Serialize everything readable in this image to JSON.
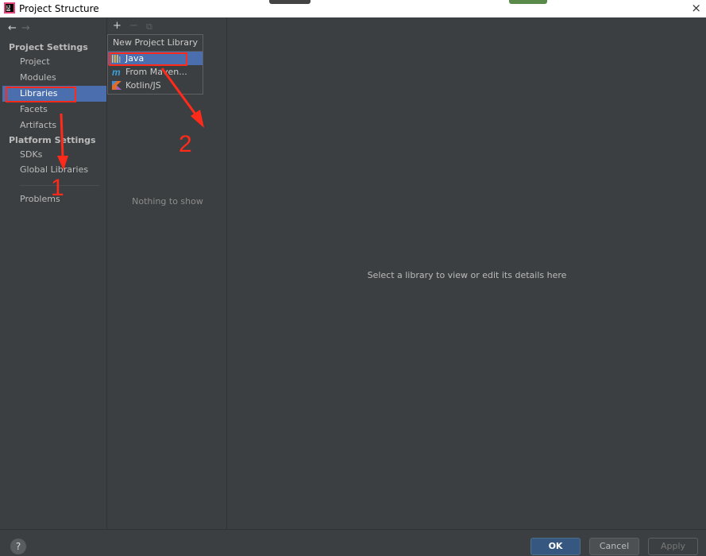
{
  "window": {
    "title": "Project Structure",
    "close_glyph": "×"
  },
  "sidebar": {
    "back_icon": "←",
    "forward_icon": "→",
    "project_settings_header": "Project Settings",
    "project_settings_items": [
      {
        "label": "Project",
        "selected": false
      },
      {
        "label": "Modules",
        "selected": false
      },
      {
        "label": "Libraries",
        "selected": true
      },
      {
        "label": "Facets",
        "selected": false
      },
      {
        "label": "Artifacts",
        "selected": false
      }
    ],
    "platform_settings_header": "Platform Settings",
    "platform_settings_items": [
      {
        "label": "SDKs"
      },
      {
        "label": "Global Libraries"
      }
    ],
    "problems_label": "Problems"
  },
  "library_panel": {
    "add_icon": "+",
    "remove_icon": "−",
    "copy_icon": "⧉",
    "empty_text": "Nothing to show"
  },
  "popup": {
    "header": "New Project Library",
    "items": [
      {
        "label": "Java",
        "icon": "java-library-icon",
        "selected": true
      },
      {
        "label": "From Maven...",
        "icon": "maven-icon",
        "selected": false
      },
      {
        "label": "Kotlin/JS",
        "icon": "kotlin-icon",
        "selected": false
      }
    ]
  },
  "detail": {
    "hint": "Select a library to view or edit its details here"
  },
  "footer": {
    "help_icon": "?",
    "ok_label": "OK",
    "cancel_label": "Cancel",
    "apply_label": "Apply"
  },
  "annotations": {
    "step1": "1",
    "step2": "2",
    "color": "#ff2a1a"
  },
  "colors": {
    "selection": "#4b6eaf",
    "background": "#3c3f41",
    "ok_button": "#365880"
  }
}
